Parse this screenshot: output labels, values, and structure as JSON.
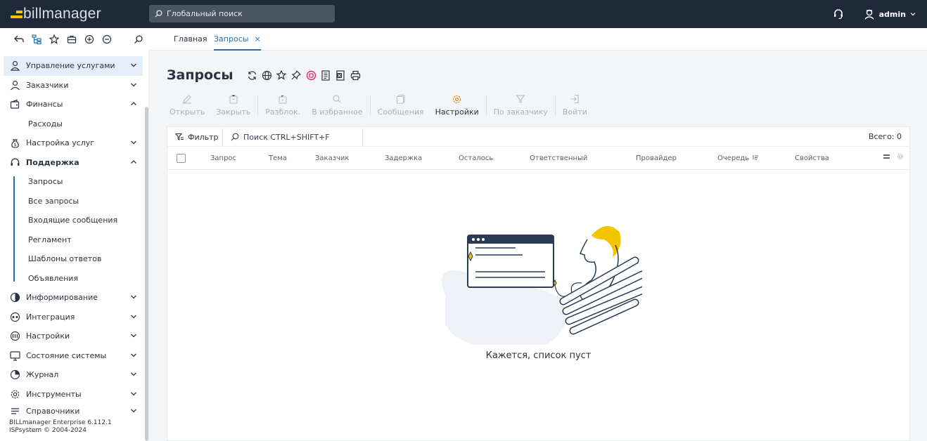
{
  "app": {
    "logo_text": "billmanager",
    "search_placeholder": "Глобальный поиск",
    "user": "admin"
  },
  "tabs": [
    {
      "label": "Главная"
    },
    {
      "label": "Запросы",
      "close": "×"
    }
  ],
  "sidebar": {
    "items": [
      {
        "label": "Управление услугами",
        "icon": "user-service-icon"
      },
      {
        "label": "Заказчики",
        "icon": "customer-icon"
      },
      {
        "label": "Финансы",
        "icon": "wallet-icon"
      },
      {
        "label": "Расходы"
      },
      {
        "label": "Настройка услуг",
        "icon": "money-bag-icon"
      },
      {
        "label": "Поддержка",
        "icon": "headset-icon"
      },
      {
        "label": "Запросы"
      },
      {
        "label": "Все запросы"
      },
      {
        "label": "Входящие сообщения"
      },
      {
        "label": "Регламент"
      },
      {
        "label": "Шаблоны ответов"
      },
      {
        "label": "Объявления"
      },
      {
        "label": "Информирование",
        "icon": "broadcast-icon"
      },
      {
        "label": "Интеграция",
        "icon": "integration-icon"
      },
      {
        "label": "Настройки",
        "icon": "settings-icon"
      },
      {
        "label": "Состояние системы",
        "icon": "monitor-icon"
      },
      {
        "label": "Журнал",
        "icon": "pie-chart-icon"
      },
      {
        "label": "Инструменты",
        "icon": "gear-icon"
      },
      {
        "label": "Справочники",
        "icon": "list-icon"
      }
    ],
    "footer_line1": "BILLmanager Enterprise 6.112.1",
    "footer_line2": "ISPsystem © 2004-2024"
  },
  "page": {
    "title": "Запросы",
    "actions": [
      {
        "label": "Открыть",
        "enabled": false
      },
      {
        "label": "Закрыть",
        "enabled": false
      },
      {
        "label": "Разблок.",
        "enabled": false
      },
      {
        "label": "В избранное",
        "enabled": false
      },
      {
        "label": "Сообщения",
        "enabled": false
      },
      {
        "label": "Настройки",
        "enabled": true
      },
      {
        "label": "По заказчику",
        "enabled": false
      },
      {
        "label": "Войти",
        "enabled": false
      }
    ],
    "filter_label": "Фильтр",
    "search_placeholder": "Поиск CTRL+SHIFT+F",
    "total": "Всего: 0",
    "columns": [
      "Запрос",
      "Тема",
      "Заказчик",
      "Задержка",
      "Осталось",
      "Ответственный",
      "Провайдер",
      "Очередь",
      "Свойства"
    ],
    "empty_text": "Кажется, список пуст"
  },
  "colors": {
    "topbar": "#1e2a3a",
    "accent": "#1f6fb2",
    "brand_yellow": "#f5c400",
    "settings_icon": "#e8892b",
    "title_icon_pink": "#d6336c"
  }
}
